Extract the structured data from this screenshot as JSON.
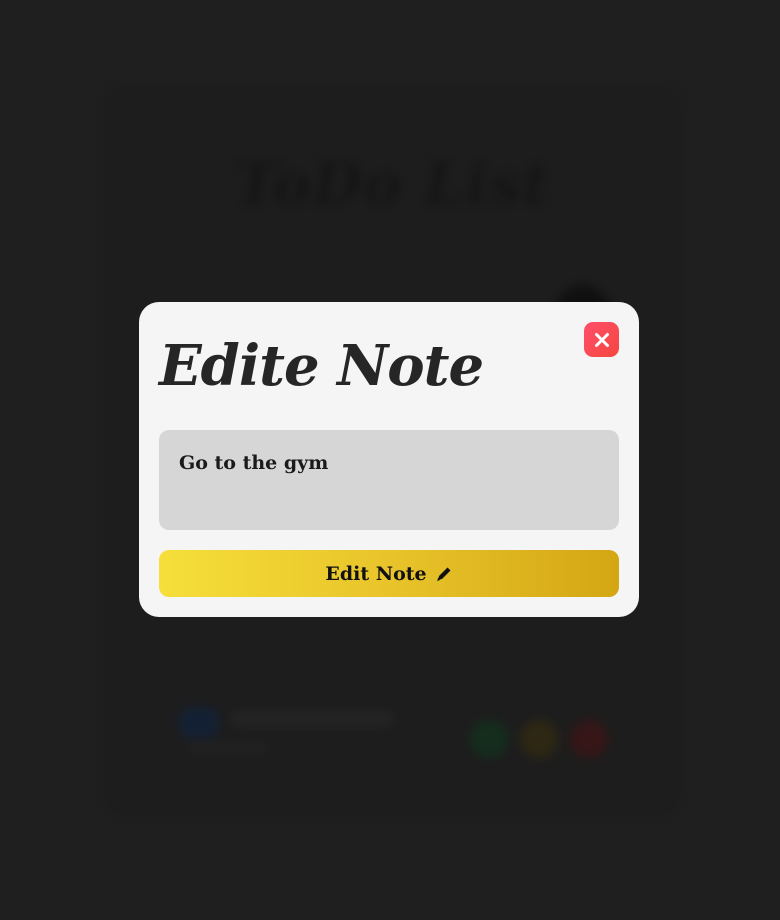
{
  "background": {
    "app_title": "ToDo List",
    "accent_colors": [
      "#0b2246",
      "#0c3a1c",
      "#3a2f0a",
      "#4a0f12"
    ]
  },
  "modal": {
    "title": "Edite Note",
    "close_icon": "close-icon",
    "note_value": "Go to the gym",
    "edit_button_label": "Edit Note",
    "edit_button_icon": "pencil-icon",
    "colors": {
      "close_button": "#f74a55",
      "edit_button_start": "#f6df3a",
      "edit_button_end": "#d4a614",
      "input_background": "#d6d6d6",
      "modal_background": "#f5f5f5"
    }
  }
}
